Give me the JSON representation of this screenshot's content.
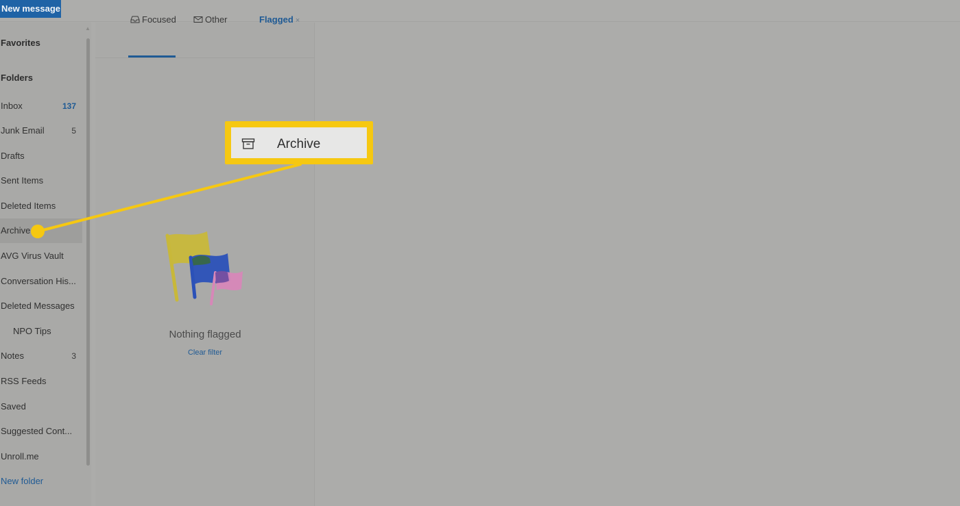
{
  "toolbar": {
    "new_message_label": "New message"
  },
  "sidebar": {
    "favorites_title": "Favorites",
    "folders_title": "Folders",
    "items": [
      {
        "label": "Inbox",
        "count": "137"
      },
      {
        "label": "Junk Email",
        "count": "5"
      },
      {
        "label": "Drafts",
        "count": ""
      },
      {
        "label": "Sent Items",
        "count": ""
      },
      {
        "label": "Deleted Items",
        "count": ""
      },
      {
        "label": "Archive",
        "count": ""
      },
      {
        "label": "AVG Virus Vault",
        "count": ""
      },
      {
        "label": "Conversation His...",
        "count": ""
      },
      {
        "label": "Deleted Messages",
        "count": ""
      },
      {
        "label": "NPO Tips",
        "count": ""
      },
      {
        "label": "Notes",
        "count": "3"
      },
      {
        "label": "RSS Feeds",
        "count": ""
      },
      {
        "label": "Saved",
        "count": ""
      },
      {
        "label": "Suggested Cont...",
        "count": ""
      },
      {
        "label": "Unroll.me",
        "count": ""
      }
    ],
    "new_folder_label": "New folder"
  },
  "tabs": {
    "focused": "Focused",
    "other": "Other",
    "flagged": "Flagged",
    "close_glyph": "×"
  },
  "empty_state": {
    "message": "Nothing flagged",
    "clear_filter": "Clear filter"
  },
  "callout": {
    "label": "Archive"
  },
  "colors": {
    "accent": "#1f5a94",
    "new_message_bg": "#1f63a6",
    "callout_yellow": "#f6c811",
    "background": "#acacaa"
  },
  "icons": {
    "focused_tab": "inbox-tray-icon",
    "other_tab": "envelope-icon",
    "callout": "archive-box-icon"
  }
}
